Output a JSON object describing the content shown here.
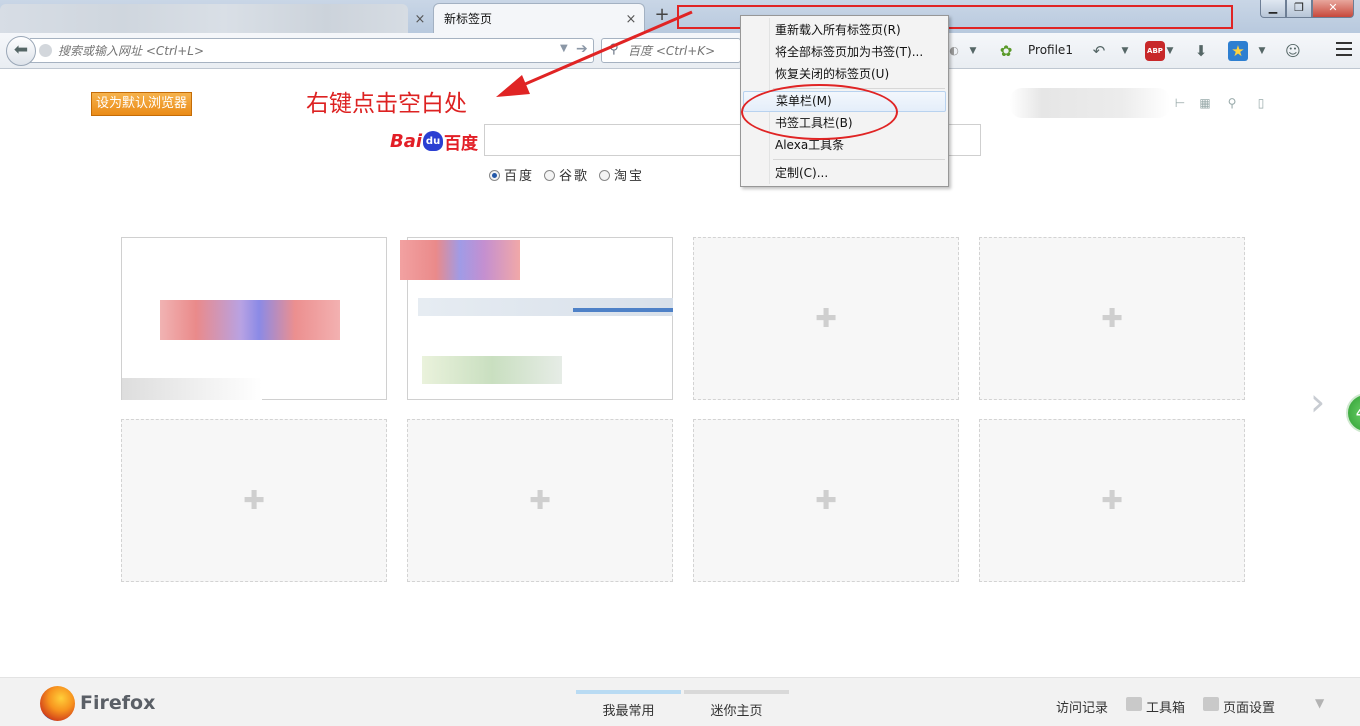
{
  "tabs": [
    {
      "title": "",
      "close": "×"
    },
    {
      "title": "新标签页",
      "close": "×"
    }
  ],
  "new_tab": "+",
  "window_controls": {
    "minimize": "▁",
    "restore": "❐",
    "close": "✕"
  },
  "nav": {
    "url_placeholder": "搜索或输入网址 <Ctrl+L>",
    "search_placeholder": "百度 <Ctrl+K>",
    "profile": "Profile1",
    "abp": "ABP"
  },
  "content": {
    "set_default_label": "设为默认浏览器",
    "annotation": "右键点击空白处",
    "baidu_logo": {
      "latin": "Bai",
      "paw": "du",
      "cn": "百度"
    },
    "engines": [
      "百度",
      "谷歌",
      "淘宝"
    ],
    "selected_engine": "百度"
  },
  "context_menu": {
    "items": [
      "重新载入所有标签页(R)",
      "将全部标签页加为书签(T)...",
      "恢复关闭的标签页(U)",
      "菜单栏(M)",
      "书签工具栏(B)",
      "Alexa工具条",
      "定制(C)..."
    ],
    "highlighted_index": 3
  },
  "side_badge": "4",
  "footer": {
    "brand": "Firefox",
    "tabs": [
      "我最常用",
      "迷你主页"
    ],
    "active_tab": "我最常用",
    "links": [
      "访问记录",
      "工具箱",
      "页面设置"
    ]
  },
  "colors": {
    "annotation_red": "#e02424",
    "default_button_orange": "#ea8b17",
    "baidu_red": "#e21e26",
    "baidu_blue": "#2b3fd2"
  }
}
